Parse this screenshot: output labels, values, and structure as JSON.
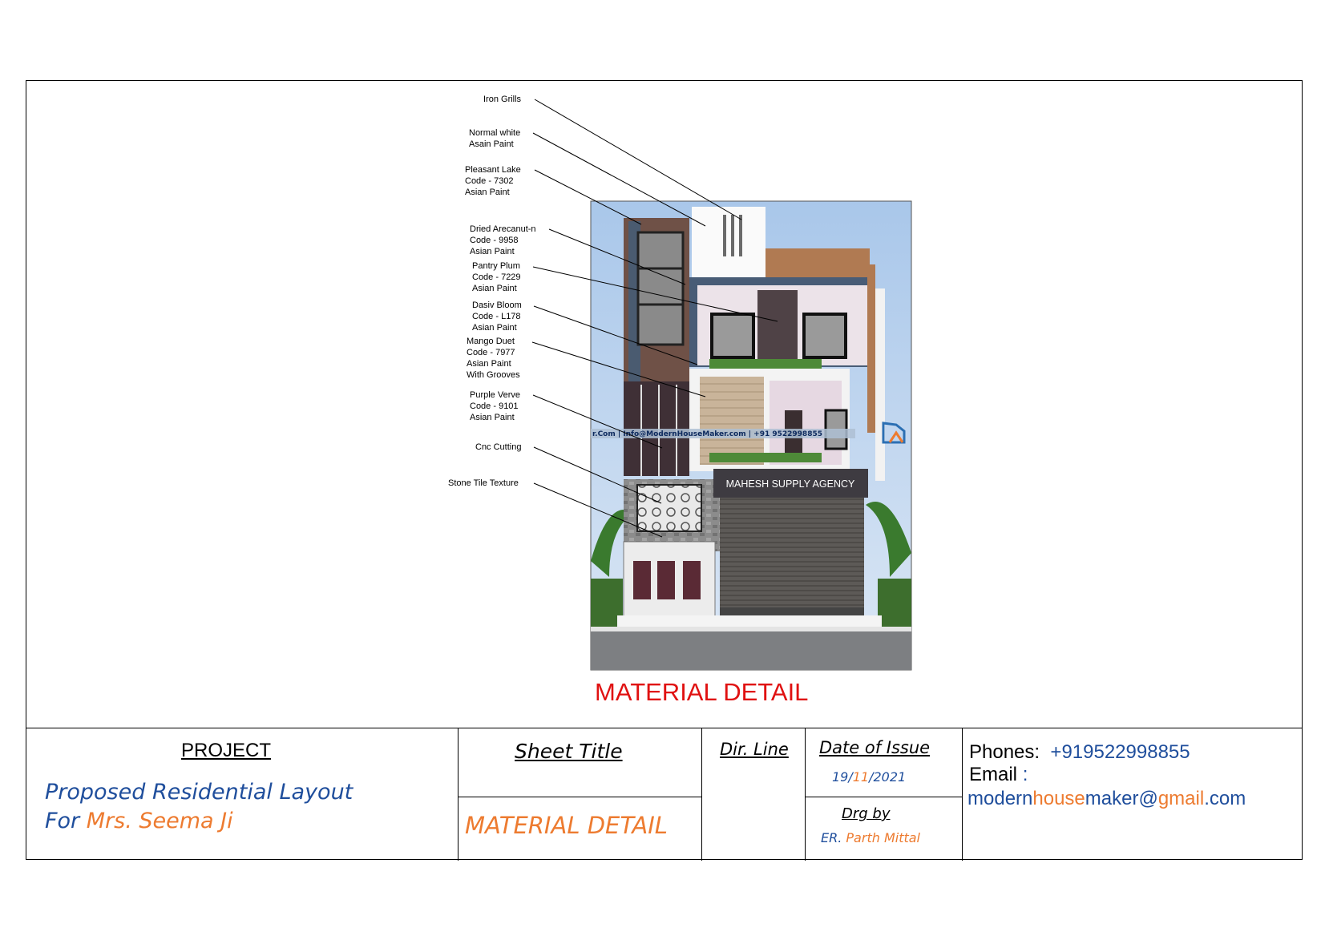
{
  "callouts": [
    {
      "id": "iron",
      "text": "Iron Grills"
    },
    {
      "id": "white",
      "text": "Normal white\nAsain Paint"
    },
    {
      "id": "lake",
      "text": "Pleasant Lake\nCode - 7302\nAsian Paint"
    },
    {
      "id": "arecanut",
      "text": "Dried Arecanut-n\nCode - 9958\nAsian Paint"
    },
    {
      "id": "plum",
      "text": "Pantry Plum\nCode - 7229\nAsian Paint"
    },
    {
      "id": "bloom",
      "text": "Dasiv Bloom\nCode - L178\nAsian Paint"
    },
    {
      "id": "mango",
      "text": "Mango Duet\nCode - 7977\nAsian Paint\nWith Grooves"
    },
    {
      "id": "verve",
      "text": "Purple Verve\nCode - 9101\nAsian Paint"
    },
    {
      "id": "cnc",
      "text": "Cnc Cutting"
    },
    {
      "id": "stone",
      "text": "Stone Tile Texture"
    }
  ],
  "render": {
    "shop_sign": "MAHESH SUPPLY AGENCY",
    "watermark": "r.Com  |  Info@ModernHouseMaker.com  |  +91 9522998855"
  },
  "main_title": "MATERIAL DETAIL",
  "title_block": {
    "project_label": "PROJECT",
    "project_line1": "Proposed Residential Layout",
    "project_for": "For",
    "project_client": "Mrs. Seema Ji",
    "sheet_title_label": "Sheet Title",
    "sheet_title_value": "MATERIAL DETAIL",
    "dir_line_label": "Dir. Line",
    "date_label": "Date of Issue",
    "date_day": "19/",
    "date_month": "11",
    "date_year": "/2021",
    "drg_by_label": "Drg by",
    "drg_prefix": "ER.",
    "drg_name": "Parth Mittal",
    "phones_label": "Phones:",
    "phones_value": "+919522998855",
    "email_label": "Email",
    "email_colon": ":",
    "email_parts": [
      "modern",
      "house",
      "maker",
      "@",
      "gmail",
      ".com"
    ]
  },
  "colors": {
    "title_red": "#e01111",
    "blue": "#1f4e9c",
    "orange": "#ed7b30"
  }
}
